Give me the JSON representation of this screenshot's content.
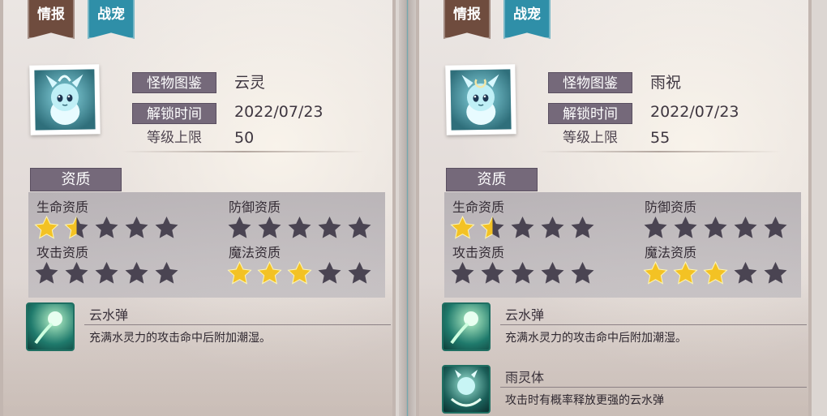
{
  "colors": {
    "star_filled": "#f3c224",
    "star_empty": "#4a4452",
    "tab_info": "#6f4c3e",
    "tab_pet": "#2f8fa8",
    "label_bg": "#75697a"
  },
  "panels": [
    {
      "tabs": {
        "info": "情报",
        "pet": "战宠"
      },
      "portrait_icon": "cloud-spirit-pet-portrait",
      "labels": {
        "monster_book": "怪物图鉴",
        "unlock_time": "解锁时间",
        "level_cap": "等级上限"
      },
      "name": "云灵",
      "unlock_date": "2022/07/23",
      "level_cap": "50",
      "aptitude_title": "资质",
      "aptitudes": {
        "hp": {
          "label": "生命资质",
          "stars": 1.5
        },
        "defense": {
          "label": "防御资质",
          "stars": 0
        },
        "attack": {
          "label": "攻击资质",
          "stars": 0
        },
        "magic": {
          "label": "魔法资质",
          "stars": 3
        }
      },
      "skills": [
        {
          "name": "云水弹",
          "desc": "充满水灵力的攻击命中后附加潮湿。",
          "icon": "water-orb-skill-icon"
        }
      ]
    },
    {
      "tabs": {
        "info": "情报",
        "pet": "战宠"
      },
      "portrait_icon": "rain-blessing-pet-portrait",
      "labels": {
        "monster_book": "怪物图鉴",
        "unlock_time": "解锁时间",
        "level_cap": "等级上限"
      },
      "name": "雨祝",
      "unlock_date": "2022/07/23",
      "level_cap": "55",
      "aptitude_title": "资质",
      "aptitudes": {
        "hp": {
          "label": "生命资质",
          "stars": 1.5
        },
        "defense": {
          "label": "防御资质",
          "stars": 0
        },
        "attack": {
          "label": "攻击资质",
          "stars": 0
        },
        "magic": {
          "label": "魔法资质",
          "stars": 3
        }
      },
      "skills": [
        {
          "name": "云水弹",
          "desc": "充满水灵力的攻击命中后附加潮湿。",
          "icon": "water-orb-skill-icon"
        },
        {
          "name": "雨灵体",
          "desc": "攻击时有概率释放更强的云水弹",
          "icon": "rain-spirit-skill-icon"
        }
      ]
    }
  ]
}
